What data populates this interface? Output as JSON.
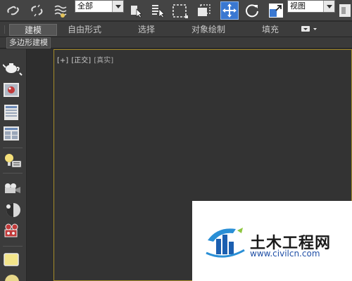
{
  "toolbar": {
    "selection_filter": "全部",
    "reference_coord": "视图",
    "icons": [
      "link-icon",
      "unlink-icon",
      "bind-spacewarp-icon",
      "select-object-icon",
      "select-by-name-icon",
      "region-select-icon",
      "window-crossing-icon",
      "move-icon",
      "rotate-icon",
      "scale-icon"
    ]
  },
  "ribbon": {
    "tabs": [
      {
        "label": "建模",
        "active": true
      },
      {
        "label": "自由形式",
        "active": false
      },
      {
        "label": "选择",
        "active": false
      },
      {
        "label": "对象绘制",
        "active": false
      },
      {
        "label": "填充",
        "active": false
      }
    ],
    "panel_label": "多边形建模"
  },
  "left_toolbar": {
    "icons": [
      "teapot-icon",
      "material-editor-icon",
      "render-setup-icon",
      "rendered-frame-icon",
      "light-icon",
      "camera-icon",
      "sphere-icon",
      "video-camera-icon",
      "yellow-box-icon",
      "sphere-yellow-icon"
    ]
  },
  "viewport": {
    "label_plus": "[+]",
    "label_view": "[正交]",
    "label_shading": "[真实]"
  },
  "watermark": {
    "title": "土木工程网",
    "url": "www.civilcn.com"
  },
  "colors": {
    "active_border": "#a58b2a",
    "accent_blue": "#3a78d1",
    "watermark_blue": "#1f4fa6"
  }
}
